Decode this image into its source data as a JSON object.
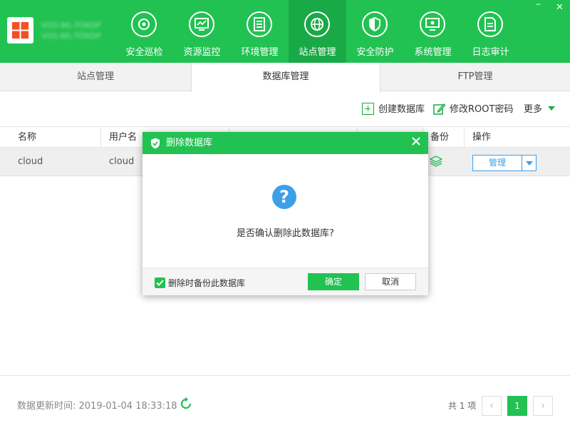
{
  "header": {
    "server_name": "VGS-WL-TOKOP",
    "server_addr": "VGS-WL-TOKOP",
    "nav": [
      {
        "label": "安全巡检",
        "icon": "inspect-icon"
      },
      {
        "label": "资源监控",
        "icon": "monitor-icon"
      },
      {
        "label": "环境管理",
        "icon": "environment-icon"
      },
      {
        "label": "站点管理",
        "icon": "globe-icon"
      },
      {
        "label": "安全防护",
        "icon": "shield-icon"
      },
      {
        "label": "系统管理",
        "icon": "system-icon"
      },
      {
        "label": "日志审计",
        "icon": "log-icon"
      }
    ],
    "active_nav": "站点管理",
    "minimize": "–",
    "close": "✕"
  },
  "tabs": [
    {
      "label": "站点管理"
    },
    {
      "label": "数据库管理"
    },
    {
      "label": "FTP管理"
    }
  ],
  "active_tab": "数据库管理",
  "toolbar": {
    "create_label": "创建数据库",
    "root_label": "修改ROOT密码",
    "more_label": "更多"
  },
  "table": {
    "headers": {
      "name": "名称",
      "user": "用户名",
      "backup": "备份",
      "action": "操作"
    },
    "rows": [
      {
        "name": "cloud",
        "user": "cloud",
        "action_label": "管理"
      }
    ]
  },
  "footer": {
    "update_time": "数据更新时间: 2019-01-04 18:33:18",
    "count": "共 1 项",
    "current_page": "1",
    "prev": "‹",
    "next": "›"
  },
  "modal": {
    "title": "删除数据库",
    "question_mark": "?",
    "message": "是否确认删除此数据库?",
    "checkbox_label": "删除时备份此数据库",
    "checkbox_checked": true,
    "ok_label": "确定",
    "cancel_label": "取消"
  },
  "colors": {
    "brand_green": "#21c252",
    "active_nav": "#1aa947",
    "accent_blue": "#3c9fea"
  }
}
